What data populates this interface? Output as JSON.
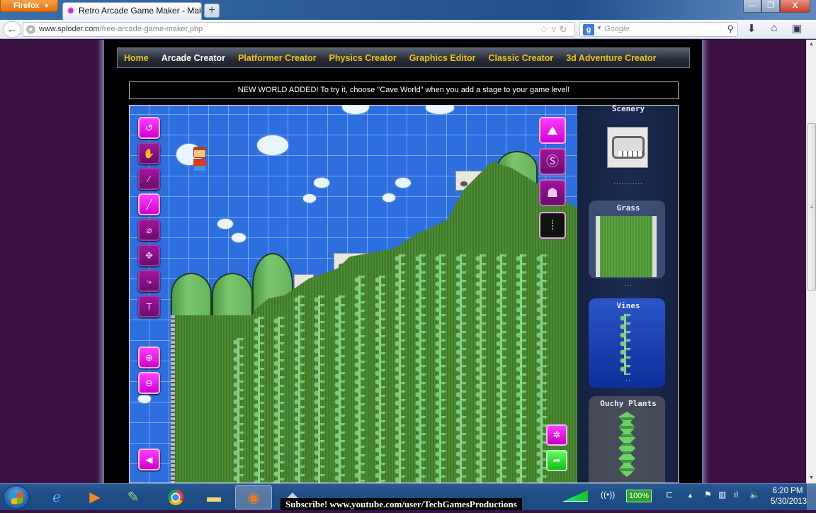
{
  "browser": {
    "menu_label": "Firefox",
    "tab_title": "Retro Arcade Game Maker - Make your ...",
    "new_tab_symbol": "+",
    "url_domain": "www.sploder.com",
    "url_path": "/free-arcade-game-maker.php",
    "search_engine": "Google",
    "search_placeholder": "Google",
    "window_buttons": {
      "minimize": "—",
      "maximize": "❐",
      "close": "X"
    }
  },
  "site_nav": {
    "items": [
      {
        "label": "Home",
        "active": false
      },
      {
        "label": "Arcade Creator",
        "active": true
      },
      {
        "label": "Platformer Creator",
        "active": false
      },
      {
        "label": "Physics Creator",
        "active": false
      },
      {
        "label": "Graphics Editor",
        "active": false
      },
      {
        "label": "Classic Creator",
        "active": false
      },
      {
        "label": "3d Adventure Creator",
        "active": false
      }
    ]
  },
  "notice": "NEW WORLD ADDED! To try it, choose \"Cave World\" when you add a stage to your game level!",
  "editor": {
    "left_tools": [
      {
        "name": "undo",
        "icon": "↺",
        "active": true
      },
      {
        "name": "hand",
        "icon": "✋",
        "active": false
      },
      {
        "name": "eyedropper",
        "icon": "⁄",
        "active": false
      },
      {
        "name": "brush",
        "icon": "╱",
        "active": true
      },
      {
        "name": "eraser",
        "icon": "⌀",
        "active": false
      },
      {
        "name": "move",
        "icon": "✥",
        "active": false
      },
      {
        "name": "path",
        "icon": "⤷",
        "active": false
      },
      {
        "name": "text",
        "icon": "T",
        "active": false
      }
    ],
    "zoom_in_icon": "⊕",
    "zoom_out_icon": "⊖",
    "collapse_icon": "◀",
    "right_tools": [
      {
        "name": "terrain",
        "icon": "⛰",
        "active": true
      },
      {
        "name": "coin",
        "icon": "Ⓢ",
        "active": false
      },
      {
        "name": "enemy",
        "icon": "☗",
        "active": false
      },
      {
        "name": "vine-layer",
        "icon": "⁞",
        "active": false
      }
    ],
    "settings_icon": "✲",
    "play_icon": "➦"
  },
  "palette": {
    "items": [
      {
        "title": "Scenery",
        "selected": false
      },
      {
        "title": "Grass",
        "selected": false
      },
      {
        "title": "Vines",
        "selected": true
      },
      {
        "title": "Ouchy Plants",
        "selected": false
      }
    ],
    "dots_long": "...........",
    "dots_short": "...",
    "dots_pair": ".."
  },
  "taskbar": {
    "apps": [
      "Internet Explorer",
      "Media Player",
      "Notepad++",
      "Chrome",
      "File Explorer",
      "Firefox",
      "Game"
    ],
    "subscribe_text": "Subscribe! www.youtube.com/user/TechGamesProductions",
    "battery": "100%",
    "time": "6:20 PM",
    "date": "5/30/2013"
  }
}
